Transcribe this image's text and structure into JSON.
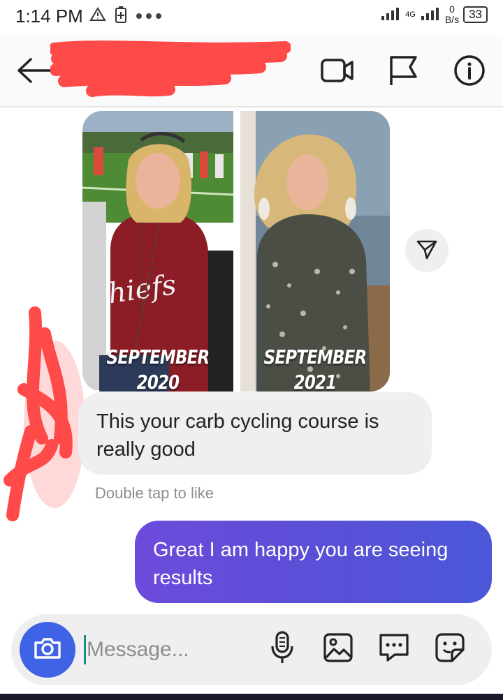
{
  "status_bar": {
    "time": "1:14 PM",
    "network_gen": "4G",
    "net_speed_value": "0",
    "net_speed_unit": "B/s",
    "battery": "33"
  },
  "header": {
    "back_icon": "arrow-left-icon",
    "video_icon": "video-camera-icon",
    "flag_icon": "flag-icon",
    "info_icon": "info-icon"
  },
  "messages": {
    "photo": {
      "left_caption_month": "SEPTEMBER",
      "left_caption_year": "2020",
      "right_caption_month": "SEPTEMBER",
      "right_caption_year": "2021",
      "left_shirt_text": "hiefs"
    },
    "received_text": "This your carb cycling course is really good",
    "like_hint": "Double tap to like",
    "sent_text": "Great I am happy you are seeing results"
  },
  "composer": {
    "placeholder": "Message...",
    "camera_icon": "camera-icon",
    "mic_icon": "microphone-icon",
    "gallery_icon": "image-icon",
    "chat_icon": "chat-bubble-icon",
    "sticker_icon": "sticker-icon"
  },
  "colors": {
    "sent_bubble": "#5a4fd6",
    "received_bubble": "#efefef",
    "camera_button": "#3f63e6",
    "redaction": "#ff4a4a"
  }
}
